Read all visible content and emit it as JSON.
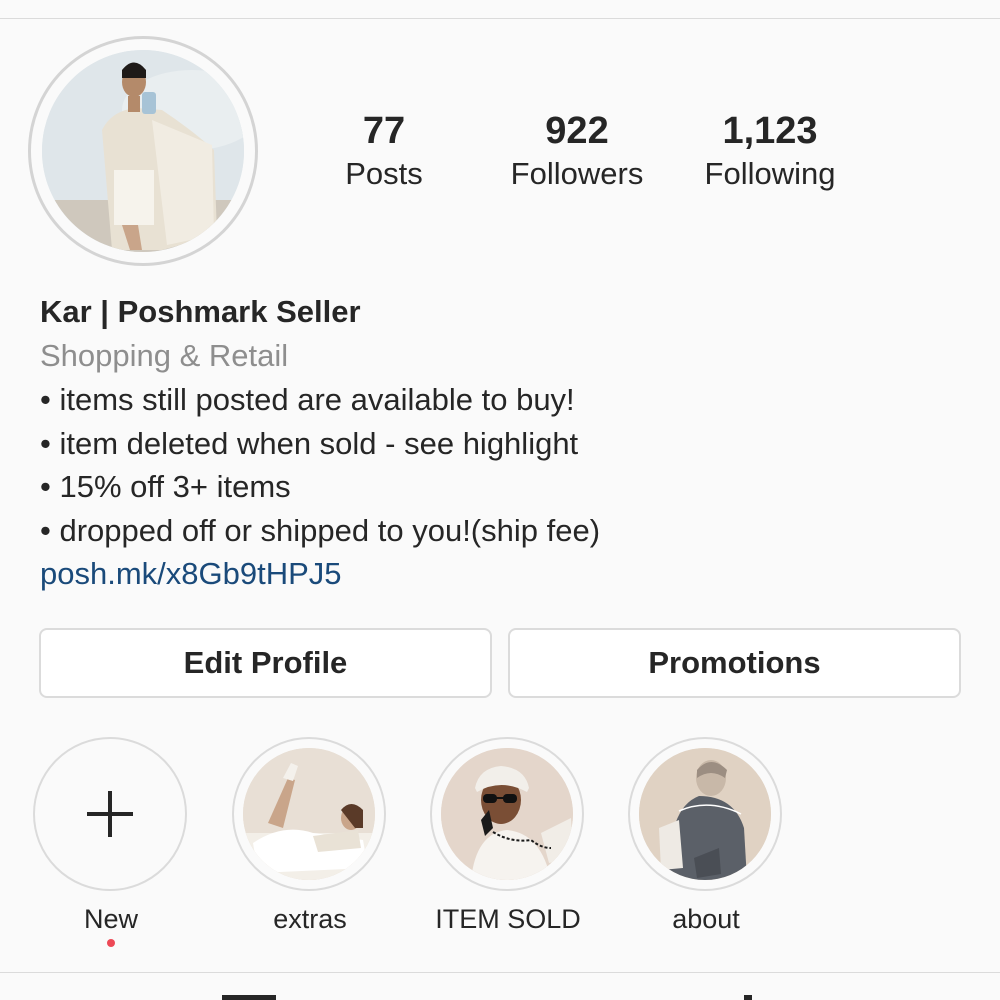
{
  "profile": {
    "avatar_icon": "profile-avatar-illustration",
    "stats": {
      "posts": {
        "count": "77",
        "label": "Posts"
      },
      "followers": {
        "count": "922",
        "label": "Followers"
      },
      "following": {
        "count": "1,123",
        "label": "Following"
      }
    },
    "bio": {
      "name": "Kar | Poshmark Seller",
      "category": "Shopping & Retail",
      "lines": [
        "• items still posted are available to buy!",
        "• item deleted when sold - see highlight",
        "• 15% off 3+ items",
        "• dropped off or shipped to you!(ship fee)"
      ],
      "link": "posh.mk/x8Gb9tHPJ5"
    },
    "buttons": {
      "edit_profile": "Edit Profile",
      "promotions": "Promotions"
    },
    "highlights": [
      {
        "label": "New",
        "icon": "plus-icon"
      },
      {
        "label": "extras"
      },
      {
        "label": "ITEM SOLD"
      },
      {
        "label": "about"
      }
    ]
  },
  "colors": {
    "background": "#fafafa",
    "text": "#262626",
    "muted": "#8e8e8e",
    "link": "#1a4a7a",
    "border": "#dbdbdb",
    "notification_dot": "#ed4956"
  }
}
